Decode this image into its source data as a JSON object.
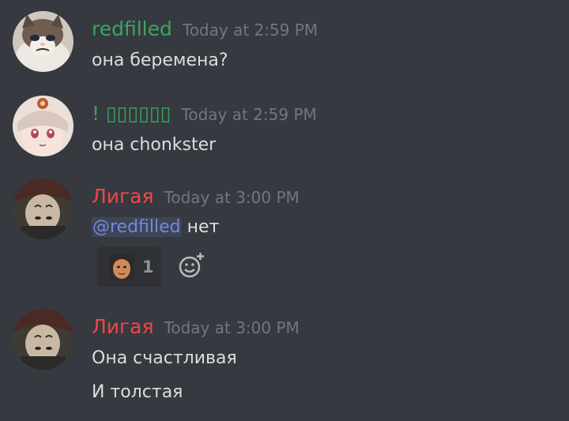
{
  "messages": [
    {
      "username": "redfilled",
      "username_color": "#3ba55c",
      "timestamp": "Today at 2:59 PM",
      "avatar": "grumpy-cat-avatar",
      "lines": [
        "она беремена?"
      ]
    },
    {
      "username": "! ▯▯▯▯▯▯",
      "username_color": "#3ba55c",
      "timestamp": "Today at 2:59 PM",
      "avatar": "anime-girl-avatar",
      "lines": [
        "она chonkster"
      ]
    },
    {
      "username": "Лигая",
      "username_color": "#f04747",
      "timestamp": "Today at 3:00 PM",
      "avatar": "upside-down-face-avatar",
      "mention": "@redfilled",
      "text_after_mention": " нет",
      "reaction": {
        "emoji": "face-emoji",
        "count": "1"
      }
    },
    {
      "username": "Лигая",
      "username_color": "#f04747",
      "timestamp": "Today at 3:00 PM",
      "avatar": "upside-down-face-avatar",
      "lines": [
        "Она счастливая",
        "И толстая"
      ]
    }
  ],
  "colors": {
    "background": "#36393f",
    "text": "#dcddde",
    "timestamp": "#72767d",
    "mention": "#7289da",
    "reaction_background": "#2f3136"
  },
  "icons": {
    "add_reaction": "add-reaction-icon"
  }
}
